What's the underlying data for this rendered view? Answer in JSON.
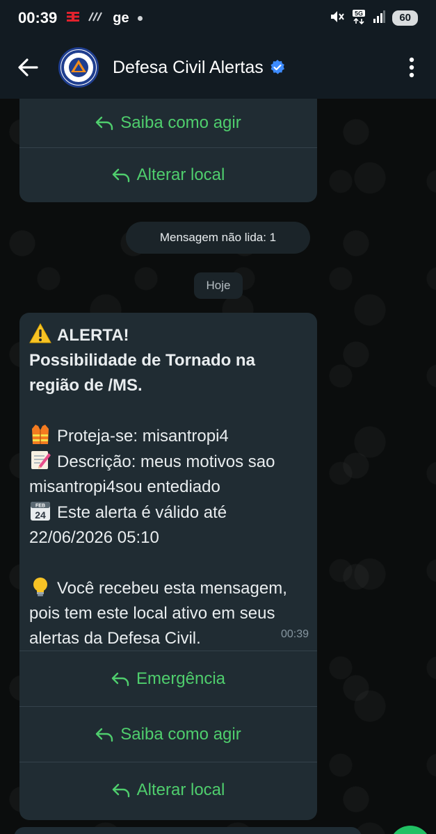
{
  "status_bar": {
    "time": "00:39",
    "carrier_mark": "TIM",
    "network": "ge",
    "battery": "60"
  },
  "header": {
    "title": "Defesa Civil Alertas",
    "back_icon": "arrow-left-icon",
    "verified_icon": "verified-badge-icon",
    "menu_icon": "more-vertical-icon"
  },
  "previous_message": {
    "actions": [
      {
        "label": "Saiba como agir"
      },
      {
        "label": "Alterar local"
      }
    ]
  },
  "unread_label": "Mensagem não lida: 1",
  "date_label": "Hoje",
  "alert_message": {
    "title": "ALERTA!",
    "headline_1": "Possibilidade de Tornado na",
    "headline_2": "região de /MS.",
    "protect": "Proteja-se: misantropi4",
    "description_1": "Descrição: meus motivos sao",
    "description_2": "misantropi4sou entediado",
    "valid_1": "Este alerta é válido até",
    "valid_2": "22/06/2026 05:10",
    "info_1": "Você recebeu esta mensagem,",
    "info_2": "pois tem este local ativo em seus",
    "info_3": "alertas da Defesa Civil.",
    "time": "00:39",
    "actions": [
      {
        "label": "Emergência"
      },
      {
        "label": "Saiba como agir"
      },
      {
        "label": "Alterar local"
      }
    ]
  },
  "colors": {
    "accent_green": "#4fce6d",
    "bubble": "#202c33",
    "header": "#121b22",
    "verified_blue": "#3d8bfd"
  }
}
